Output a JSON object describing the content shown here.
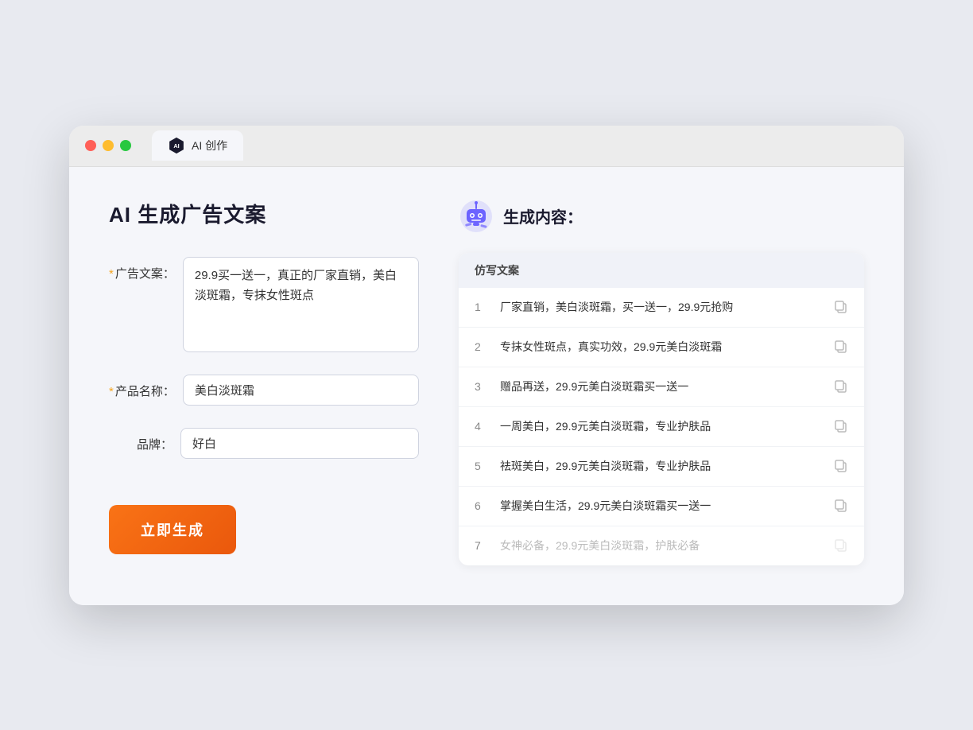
{
  "browser": {
    "tab_label": "AI 创作",
    "traffic_lights": [
      "red",
      "yellow",
      "green"
    ]
  },
  "left_panel": {
    "title": "AI 生成广告文案",
    "form": {
      "ad_copy_label": "广告文案：",
      "ad_copy_required": "*",
      "ad_copy_value": "29.9买一送一，真正的厂家直销，美白淡斑霜，专抹女性斑点",
      "product_name_label": "产品名称：",
      "product_name_required": "*",
      "product_name_value": "美白淡斑霜",
      "brand_label": "品牌：",
      "brand_value": "好白"
    },
    "generate_button": "立即生成"
  },
  "right_panel": {
    "title": "生成内容：",
    "table_header": "仿写文案",
    "rows": [
      {
        "num": "1",
        "text": "厂家直销，美白淡斑霜，买一送一，29.9元抢购",
        "faded": false
      },
      {
        "num": "2",
        "text": "专抹女性斑点，真实功效，29.9元美白淡斑霜",
        "faded": false
      },
      {
        "num": "3",
        "text": "赠品再送，29.9元美白淡斑霜买一送一",
        "faded": false
      },
      {
        "num": "4",
        "text": "一周美白，29.9元美白淡斑霜，专业护肤品",
        "faded": false
      },
      {
        "num": "5",
        "text": "祛斑美白，29.9元美白淡斑霜，专业护肤品",
        "faded": false
      },
      {
        "num": "6",
        "text": "掌握美白生活，29.9元美白淡斑霜买一送一",
        "faded": false
      },
      {
        "num": "7",
        "text": "女神必备，29.9元美白淡斑霜，护肤必备",
        "faded": true
      }
    ]
  }
}
